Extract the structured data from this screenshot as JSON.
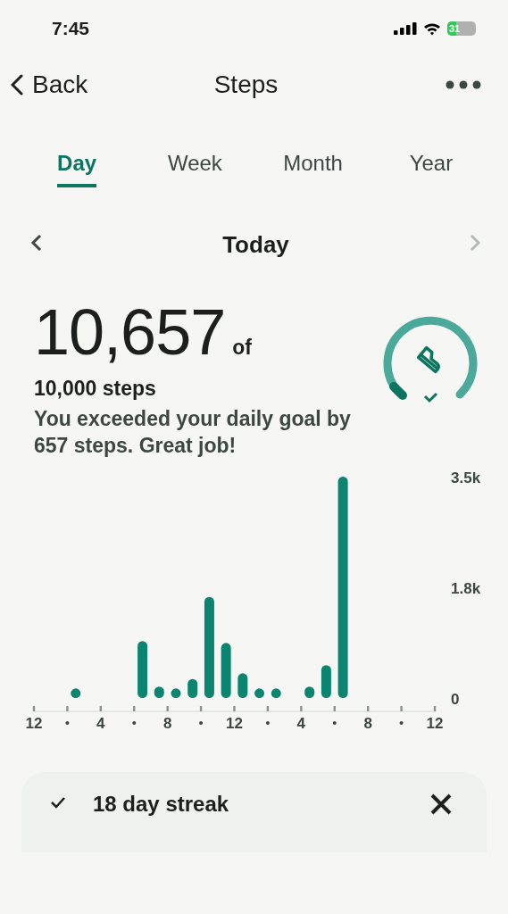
{
  "status_bar": {
    "time": "7:45",
    "battery": "31"
  },
  "nav": {
    "back": "Back",
    "title": "Steps"
  },
  "tabs": [
    {
      "label": "Day",
      "selected": true
    },
    {
      "label": "Week",
      "selected": false
    },
    {
      "label": "Month",
      "selected": false
    },
    {
      "label": "Year",
      "selected": false
    }
  ],
  "date_nav": {
    "label": "Today",
    "next_disabled": true
  },
  "summary": {
    "count": "10,657",
    "of": "of",
    "goal": "10,000 steps",
    "message": "You exceeded your daily goal by 657 steps. Great job!"
  },
  "chart": {
    "chart_data": {
      "type": "bar",
      "x": [
        2.5,
        6.5,
        7.5,
        8.5,
        9.5,
        10.5,
        11.5,
        12.5,
        13.5,
        14.5,
        16.5,
        17.5,
        18.5
      ],
      "values": [
        150,
        900,
        180,
        150,
        300,
        1600,
        870,
        390,
        150,
        150,
        180,
        520,
        3500
      ],
      "ylim": [
        0,
        3500
      ],
      "yticks": [
        {
          "value": 0,
          "label": "0"
        },
        {
          "value": 1750,
          "label": "1.8k"
        },
        {
          "value": 3500,
          "label": "3.5k"
        }
      ],
      "xlim": [
        0,
        24
      ],
      "xticks": [
        4,
        8,
        12
      ]
    },
    "midnight_label": "12",
    "evening_labels": [
      "4",
      "8",
      "12"
    ]
  },
  "streak_card": {
    "label": "18 day streak"
  }
}
